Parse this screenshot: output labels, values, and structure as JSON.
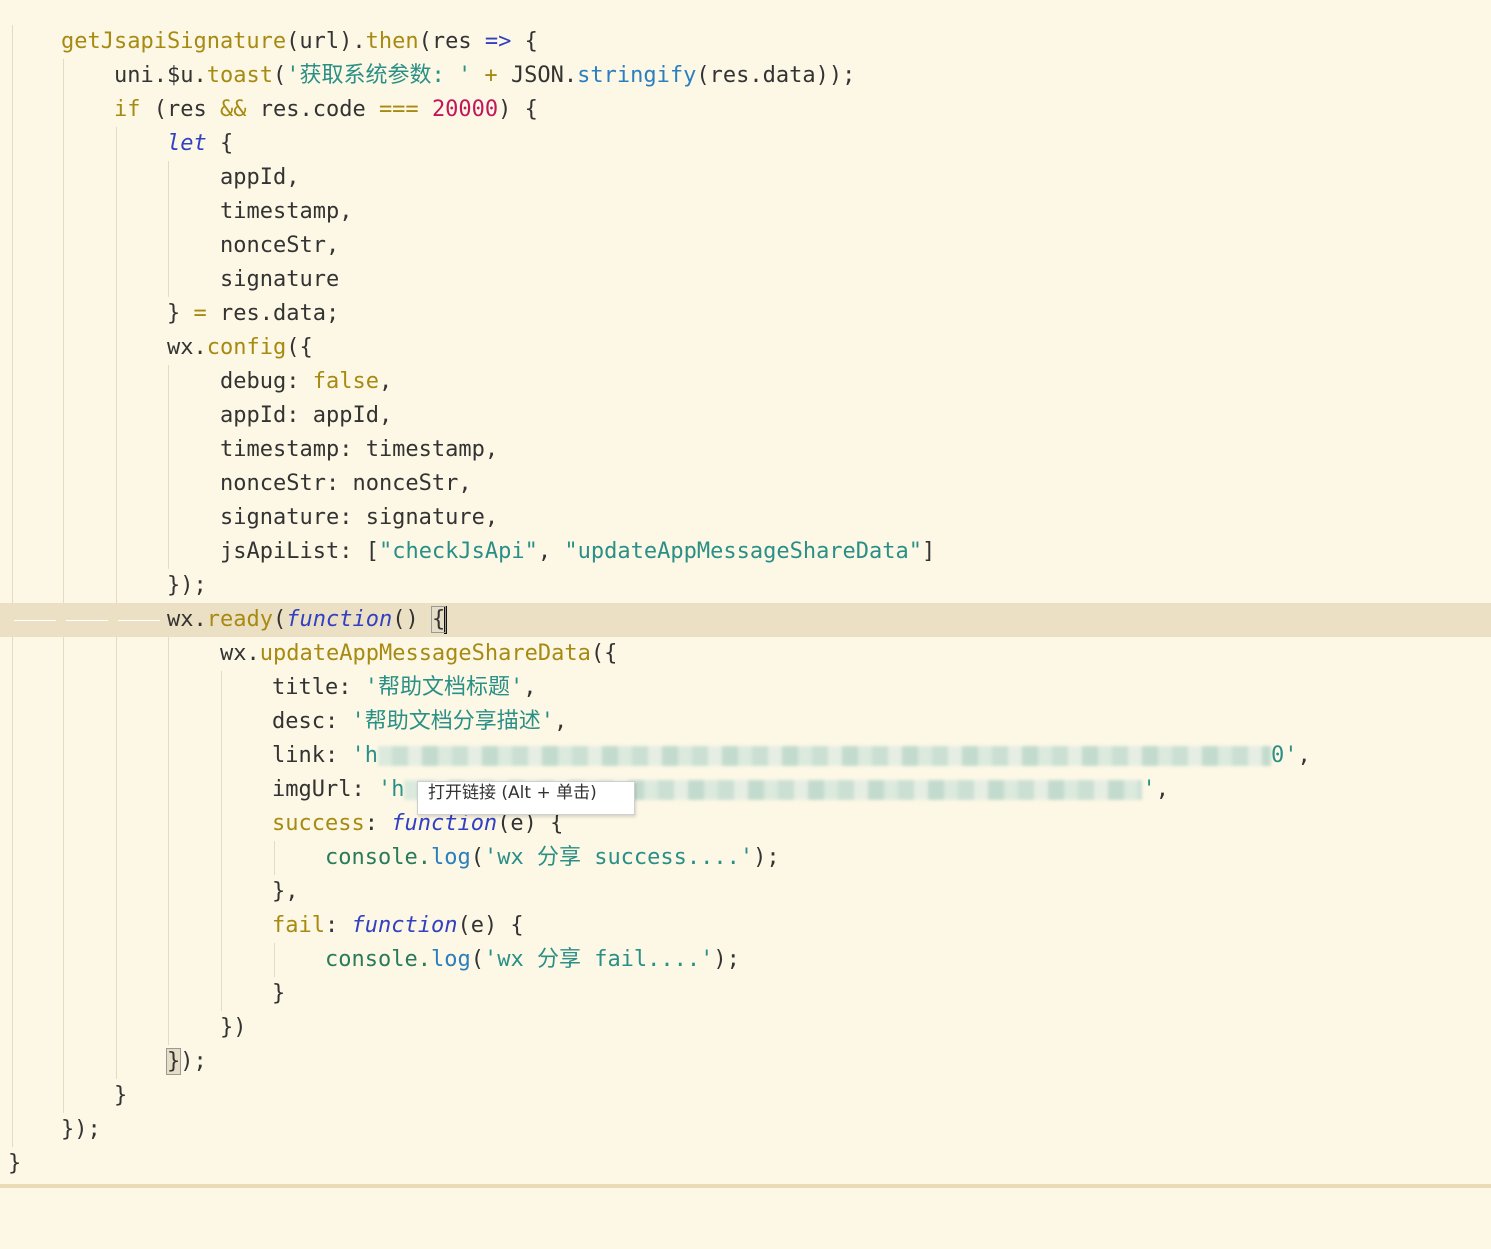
{
  "editor": {
    "lines": [
      [
        "getJsapiSignature(url).then(res => {"
      ],
      [
        "uni.$u.toast('获取系统参数: ' + JSON.stringify(res.data));"
      ],
      [
        "if (res && res.code === 20000) {"
      ],
      [
        "let {"
      ],
      [
        "appId,"
      ],
      [
        "timestamp,"
      ],
      [
        "nonceStr,"
      ],
      [
        "signature"
      ],
      [
        "} = res.data;"
      ],
      [
        "wx.config({"
      ],
      [
        "debug: false,"
      ],
      [
        "appId: appId,"
      ],
      [
        "timestamp: timestamp,"
      ],
      [
        "nonceStr: nonceStr,"
      ],
      [
        "signature: signature,"
      ],
      [
        "jsApiList: [\"checkJsApi\", \"updateAppMessageShareData\"]"
      ],
      [
        "});"
      ],
      [
        "wx.ready(function() {"
      ],
      [
        "wx.updateAppMessageShareData({"
      ],
      [
        "title: '帮助文档标题',"
      ],
      [
        "desc: '帮助文档分享描述',"
      ],
      [
        "link: 'h…0',"
      ],
      [
        "imgUrl: 'h…',"
      ],
      [
        "success: function(e) {"
      ],
      [
        "console.log('wx 分享 success....');"
      ],
      [
        "},"
      ],
      [
        "fail: function(e) {"
      ],
      [
        "console.log('wx 分享 fail....');"
      ],
      [
        "}"
      ],
      [
        "})"
      ],
      [
        "});"
      ],
      [
        "}"
      ],
      [
        "});"
      ],
      [
        "}"
      ]
    ],
    "tokens": {
      "l1_fn": "getJsapiSignature",
      "l1_a": "(url).",
      "l1_then": "then",
      "l1_b": "(res ",
      "l1_arrow": "=>",
      "l1_c": " {",
      "l2_a": "uni.$u.",
      "l2_toast": "toast",
      "l2_b": "(",
      "l2_str": "'获取系统参数: '",
      "l2_plus": " + ",
      "l2_c": "JSON.",
      "l2_stringify": "stringify",
      "l2_d": "(res.data));",
      "l3_if": "if",
      "l3_a": " (res ",
      "l3_and": "&&",
      "l3_b": " res.code ",
      "l3_eq": "===",
      "l3_sp": " ",
      "l3_num": "20000",
      "l3_c": ") {",
      "l4_let": "let",
      "l4_a": " {",
      "l5": "appId,",
      "l6": "timestamp,",
      "l7": "nonceStr,",
      "l8": "signature",
      "l9_a": "} ",
      "l9_eq": "=",
      "l9_b": " res.data;",
      "l10_a": "wx.",
      "l10_config": "config",
      "l10_b": "({",
      "l11_a": "debug: ",
      "l11_false": "false",
      "l11_b": ",",
      "l12": "appId: appId,",
      "l13": "timestamp: timestamp,",
      "l14": "nonceStr: nonceStr,",
      "l15": "signature: signature,",
      "l16_a": "jsApiList: [",
      "l16_s1": "\"checkJsApi\"",
      "l16_b": ", ",
      "l16_s2": "\"updateAppMessageShareData\"",
      "l16_c": "]",
      "l17": "});",
      "l18_a": "wx.",
      "l18_ready": "ready",
      "l18_b": "(",
      "l18_fn": "function",
      "l18_c": "() ",
      "l18_brace": "{",
      "l19_a": "wx.",
      "l19_m": "updateAppMessageShareData",
      "l19_b": "({",
      "l20_a": "title: ",
      "l20_s": "'帮助文档标题'",
      "l20_b": ",",
      "l21_a": "desc: ",
      "l21_s": "'帮助文档分享描述'",
      "l21_b": ",",
      "l22_a": "link: ",
      "l22_s1": "'h",
      "l22_s2": "0'",
      "l22_b": ",",
      "l23_a": "imgUrl: ",
      "l23_s1": "'h",
      "l23_s2": "'",
      "l23_b": ",",
      "l24_k": "success",
      "l24_a": ": ",
      "l24_fn": "function",
      "l24_b": "(e) {",
      "l25_a": "console.",
      "l25_log": "log",
      "l25_b": "(",
      "l25_s": "'wx 分享 success....'",
      "l25_c": ");",
      "l26": "},",
      "l27_k": "fail",
      "l27_a": ": ",
      "l27_fn": "function",
      "l27_b": "(e) {",
      "l28_a": "console.",
      "l28_log": "log",
      "l28_b": "(",
      "l28_s": "'wx 分享 fail....'",
      "l28_c": ");",
      "l29": "}",
      "l30": "})",
      "l31_brace": "}",
      "l31_a": ");",
      "l32": "}",
      "l33": "});",
      "l34": "}"
    }
  },
  "tooltip": {
    "text": "打开链接 (Alt + 单击)"
  },
  "colors": {
    "background": "#fdf8e5",
    "current_line": "#ece0c4",
    "keyword": "#a78a12",
    "italic_keyword": "#3240c2",
    "string": "#2a8f86",
    "number": "#c2185b",
    "method": "#2b7fbf"
  }
}
